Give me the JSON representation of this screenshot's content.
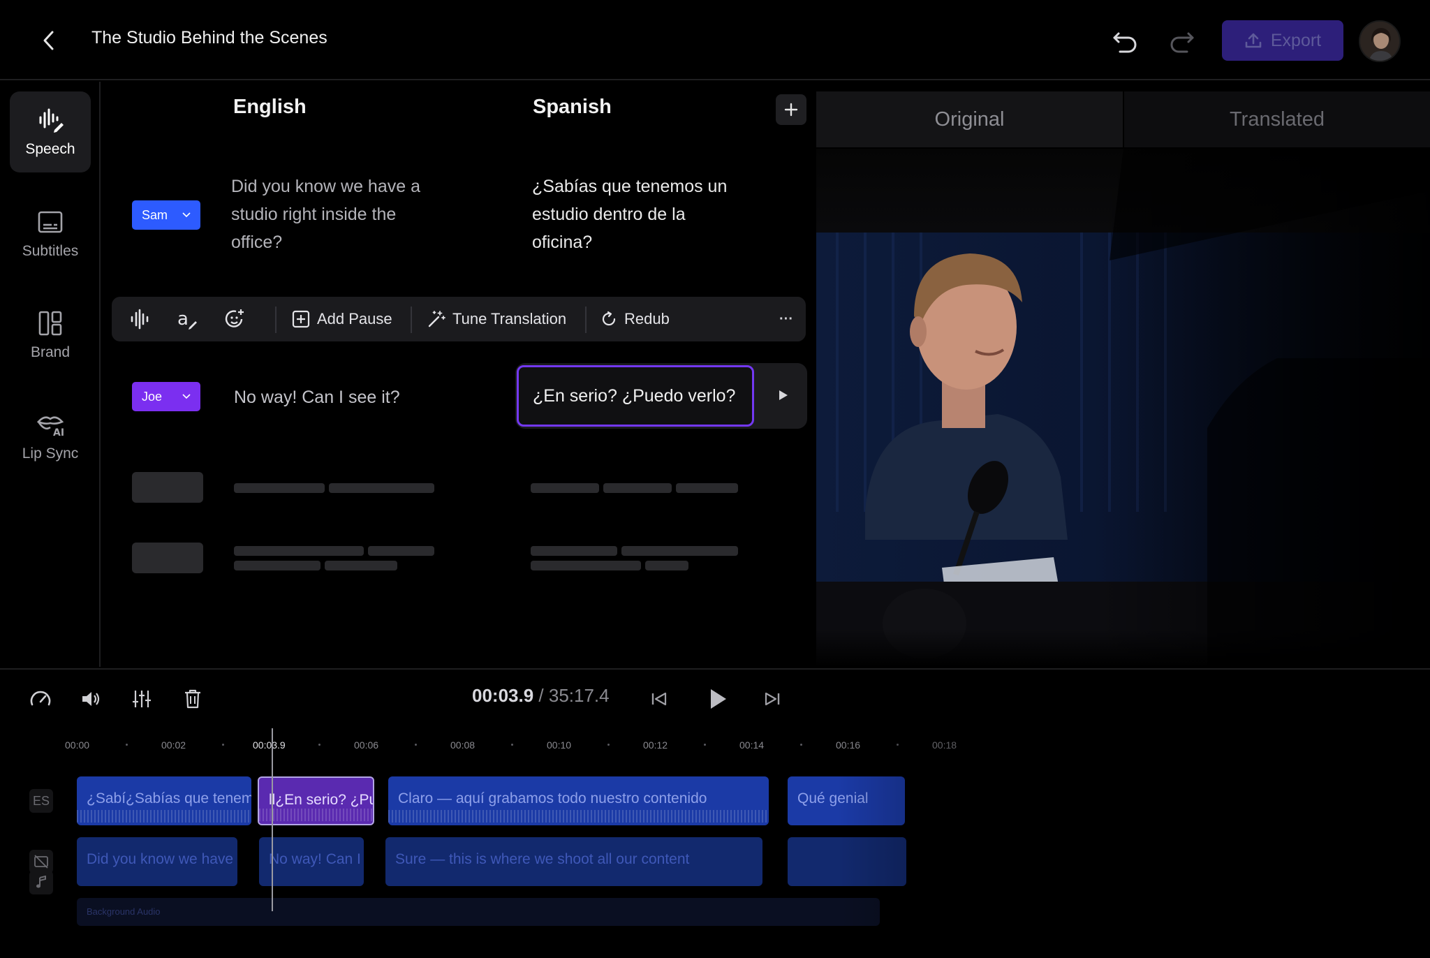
{
  "header": {
    "title": "The Studio Behind the Scenes",
    "export_label": "Export"
  },
  "rail": {
    "items": [
      {
        "label": "Speech",
        "icon": "speech-waveform-icon",
        "active": true
      },
      {
        "label": "Subtitles",
        "icon": "subtitles-icon",
        "active": false
      },
      {
        "label": "Brand",
        "icon": "brand-layout-icon",
        "active": false
      },
      {
        "label": "Lip Sync",
        "icon": "lip-sync-ai-icon",
        "active": false
      }
    ]
  },
  "script": {
    "source_language": "English",
    "target_language": "Spanish",
    "lines": [
      {
        "speaker": "Sam",
        "speaker_color": "#2d5bff",
        "source_lines": [
          "Did you know we have a",
          "studio right inside the",
          "office?"
        ],
        "target_lines": [
          "¿Sabías que tenemos un",
          "estudio dentro de la",
          "oficina?"
        ]
      },
      {
        "speaker": "Joe",
        "speaker_color": "#7b2ff0",
        "source": "No way! Can I see it?",
        "target": "¿En serio? ¿Puedo verlo?"
      }
    ],
    "toolbar": {
      "add_pause": "Add Pause",
      "tune_translation": "Tune Translation",
      "redub": "Redub",
      "more": "···"
    }
  },
  "preview": {
    "tab_original": "Original",
    "tab_translated": "Translated"
  },
  "transport": {
    "current_time": "00:03.9",
    "separator": " / ",
    "total_time": "35:17.4"
  },
  "timeline": {
    "ticks": [
      "00:00",
      "00:02",
      "00:03.9",
      "00:06",
      "00:08",
      "00:10",
      "00:12",
      "00:14",
      "00:16",
      "00:18"
    ],
    "track_es_label": "ES",
    "es_clips": [
      "¿Sabí¿Sabías que tenemos un estudio",
      "ll¿En serio? ¿Puedo verlo?",
      "Claro — aquí grabamos todo nuestro contenido",
      "Qué genial"
    ],
    "en_clips": [
      "Did you know we have a studio",
      "No way! Can I see it?",
      "Sure — this is where we shoot all our content",
      ""
    ],
    "background_audio_label": "Background Audio"
  },
  "colors": {
    "accent_purple": "#7338f2",
    "export_bg": "#2d1f7a",
    "sam_blue": "#2d5bff",
    "joe_purple": "#7b2ff0"
  }
}
